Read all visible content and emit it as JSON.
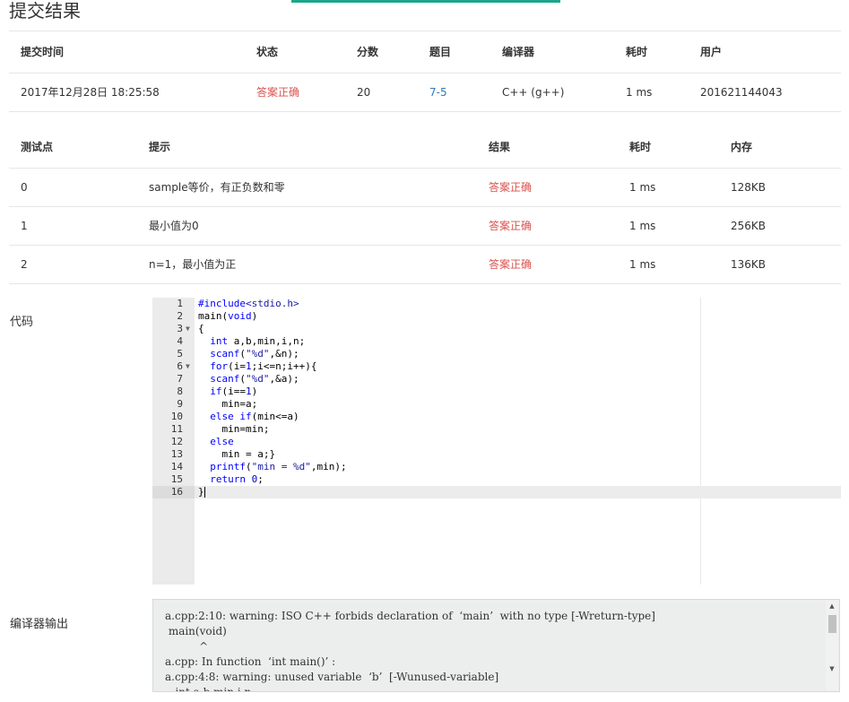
{
  "page": {
    "title": "提交结果"
  },
  "summary": {
    "columns": [
      "提交时间",
      "状态",
      "分数",
      "题目",
      "编译器",
      "耗时",
      "用户"
    ],
    "row": {
      "submit_time": "2017年12月28日 18:25:58",
      "status": "答案正确",
      "score": "20",
      "problem": "7-5",
      "compiler": "C++ (g++)",
      "time": "1 ms",
      "user": "201621144043"
    }
  },
  "test_cases": {
    "columns": [
      "测试点",
      "提示",
      "结果",
      "耗时",
      "内存"
    ],
    "rows": [
      {
        "id": "0",
        "hint": "sample等价，有正负数和零",
        "result": "答案正确",
        "time": "1 ms",
        "memory": "128KB"
      },
      {
        "id": "1",
        "hint": "最小值为0",
        "result": "答案正确",
        "time": "1 ms",
        "memory": "256KB"
      },
      {
        "id": "2",
        "hint": "n=1，最小值为正",
        "result": "答案正确",
        "time": "1 ms",
        "memory": "136KB"
      }
    ]
  },
  "code_section": {
    "label": "代码",
    "line_numbers": [
      "1",
      "2",
      "3",
      "4",
      "5",
      "6",
      "7",
      "8",
      "9",
      "10",
      "11",
      "12",
      "13",
      "14",
      "15",
      "16"
    ],
    "lines": [
      "#include<stdio.h>",
      "main(void)",
      "{",
      "  int a,b,min,i,n;",
      "  scanf(\"%d\",&n);",
      "  for(i=1;i<=n;i++){",
      "  scanf(\"%d\",&a);",
      "  if(i==1)",
      "    min=a;",
      "  else if(min<=a)",
      "    min=min;",
      "  else",
      "    min = a;}",
      "  printf(\"min = %d\",min);",
      "  return 0;",
      "}"
    ]
  },
  "compiler_output": {
    "label": "编译器输出",
    "text": "a.cpp:2:10: warning: ISO C++ forbids declaration of  ‘main’  with no type [-Wreturn-type]\n main(void)\n          ^\na.cpp: In function  ‘int main()’ :\na.cpp:4:8: warning: unused variable  ‘b’  [-Wunused-variable]\n   int a,b,min,i,n;"
  },
  "colors": {
    "accent": "#1aa68a",
    "status_accepted": "#d9534f",
    "link": "#337ab7"
  }
}
